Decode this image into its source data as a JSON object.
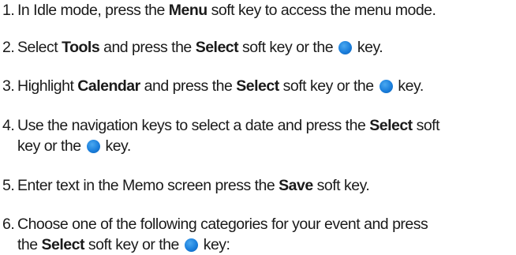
{
  "steps": [
    {
      "number": "1.",
      "lines": [
        [
          {
            "t": "text",
            "v": "In Idle mode, press the "
          },
          {
            "t": "bold",
            "v": "Menu"
          },
          {
            "t": "text",
            "v": " soft key to access the menu mode."
          }
        ]
      ]
    },
    {
      "number": "2.",
      "lines": [
        [
          {
            "t": "text",
            "v": "Select "
          },
          {
            "t": "bold",
            "v": "Tools"
          },
          {
            "t": "text",
            "v": " and press the "
          },
          {
            "t": "bold",
            "v": "Select"
          },
          {
            "t": "text",
            "v": " soft key or the "
          },
          {
            "t": "icon",
            "v": "select-key-icon"
          },
          {
            "t": "text",
            "v": " key."
          }
        ]
      ]
    },
    {
      "number": "3.",
      "lines": [
        [
          {
            "t": "text",
            "v": "Highlight "
          },
          {
            "t": "bold",
            "v": "Calendar"
          },
          {
            "t": "text",
            "v": " and press the "
          },
          {
            "t": "bold",
            "v": "Select"
          },
          {
            "t": "text",
            "v": " soft key or the "
          },
          {
            "t": "icon",
            "v": "select-key-icon"
          },
          {
            "t": "text",
            "v": " key."
          }
        ]
      ]
    },
    {
      "number": "4.",
      "lines": [
        [
          {
            "t": "text",
            "v": "Use the navigation keys to select a date and press the "
          },
          {
            "t": "bold",
            "v": "Select"
          },
          {
            "t": "text",
            "v": " soft"
          }
        ],
        [
          {
            "t": "text",
            "v": "key or the "
          },
          {
            "t": "icon",
            "v": "select-key-icon"
          },
          {
            "t": "text",
            "v": " key."
          }
        ]
      ]
    },
    {
      "number": "5.",
      "lines": [
        [
          {
            "t": "text",
            "v": "Enter text in the Memo screen press the "
          },
          {
            "t": "bold",
            "v": "Save"
          },
          {
            "t": "text",
            "v": " soft key."
          }
        ]
      ]
    },
    {
      "number": "6.",
      "lines": [
        [
          {
            "t": "text",
            "v": "Choose one of the following categories for your event and press"
          }
        ],
        [
          {
            "t": "text",
            "v": "the "
          },
          {
            "t": "bold",
            "v": "Select"
          },
          {
            "t": "text",
            "v": " soft key or the "
          },
          {
            "t": "icon",
            "v": "select-key-icon"
          },
          {
            "t": "text",
            "v": " key:"
          }
        ]
      ]
    }
  ]
}
